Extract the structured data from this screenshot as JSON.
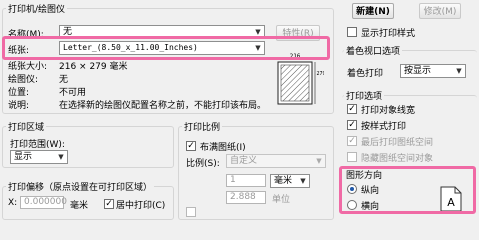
{
  "printer_group": {
    "title": "打印机/绘图仪",
    "name_label": "名称(M):",
    "name_value": "无",
    "properties_button": "特性(R)",
    "paper_label": "纸张:",
    "paper_value": "Letter_(8.50_x_11.00_Inches)",
    "paper_size_label": "纸张大小:",
    "paper_size_value": "216 × 279  毫米",
    "plotter_label": "绘图仪:",
    "plotter_value": "无",
    "where_label": "位置:",
    "where_value": "不可用",
    "description_label": "说明:",
    "description_value": "在选择新的绘图仪配置名称之前，不能打印该布局。",
    "preview_dim_top": "216",
    "preview_dim_side": "279"
  },
  "page_setup": {
    "new_button": "新建(N)",
    "modify_button": "修改(M)",
    "show_plot_styles": "显示打印样式"
  },
  "shaded_viewport": {
    "title": "着色视口选项",
    "shade_plot_label": "着色打印",
    "shade_plot_value": "按显示"
  },
  "plot_options": {
    "title": "打印选项",
    "items": [
      {
        "label": "打印对象线宽",
        "checked": true,
        "enabled": true
      },
      {
        "label": "按样式打印",
        "checked": true,
        "enabled": true
      },
      {
        "label": "最后打印图纸空间",
        "checked": true,
        "enabled": false
      },
      {
        "label": "隐藏图纸空间对象",
        "checked": false,
        "enabled": false
      }
    ]
  },
  "orientation": {
    "title": "图形方向",
    "portrait": "纵向",
    "landscape": "横向",
    "selected": "portrait",
    "icon_letter": "A"
  },
  "plot_area": {
    "title": "打印区域",
    "range_label": "打印范围(W):",
    "range_value": "显示"
  },
  "plot_scale": {
    "title": "打印比例",
    "fit_to_paper": "布满图纸(I)",
    "scale_label": "比例(S):",
    "scale_value": "自定义",
    "value1": "1",
    "unit_value": "毫米",
    "value2": "2.888",
    "units_label": "单位"
  },
  "plot_offset": {
    "title": "打印偏移（原点设置在可打印区域）",
    "x_label": "X:",
    "x_value": "0.000000",
    "x_unit": "毫米",
    "center_plot": "居中打印(C)"
  }
}
